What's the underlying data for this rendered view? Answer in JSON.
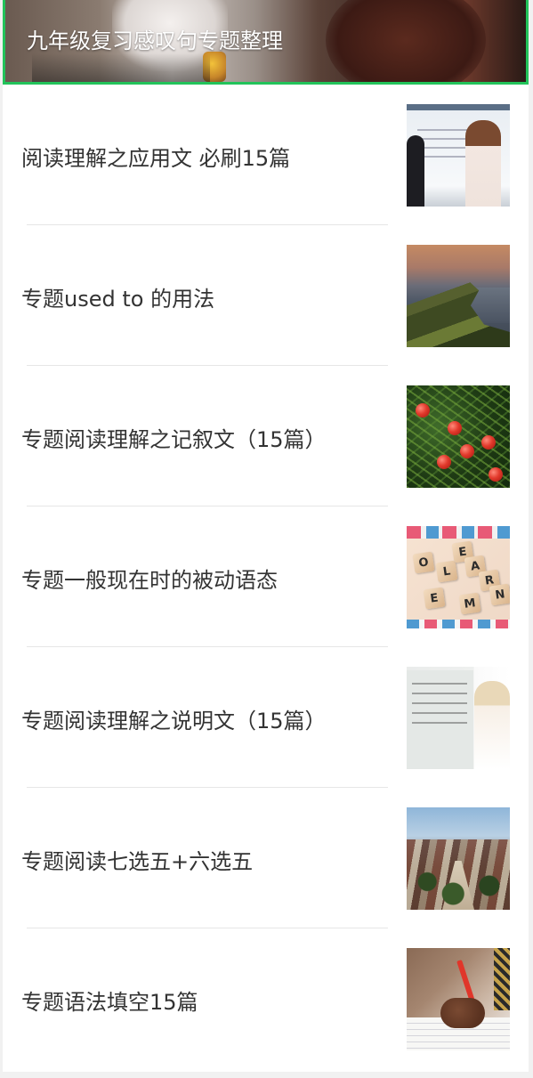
{
  "banner": {
    "title": "九年级复习感叹句专题整理",
    "accent_color": "#22c35a"
  },
  "articles": [
    {
      "title": "阅读理解之应用文 必刷15篇",
      "thumbnail": "classroom-whiteboard-photo"
    },
    {
      "title": "专题used to 的用法",
      "thumbnail": "coastal-cliff-photo"
    },
    {
      "title": "专题阅读理解之记叙文（15篇）",
      "thumbnail": "red-berries-photo"
    },
    {
      "title": "专题一般现在时的被动语态",
      "thumbnail": "letter-tiles-learn-photo"
    },
    {
      "title": "专题阅读理解之说明文（15篇）",
      "thumbnail": "teacher-whiteboard-photo"
    },
    {
      "title": "专题阅读七选五+六选五",
      "thumbnail": "village-street-photo"
    },
    {
      "title": "专题语法填空15篇",
      "thumbnail": "hand-writing-pencil-photo"
    }
  ]
}
